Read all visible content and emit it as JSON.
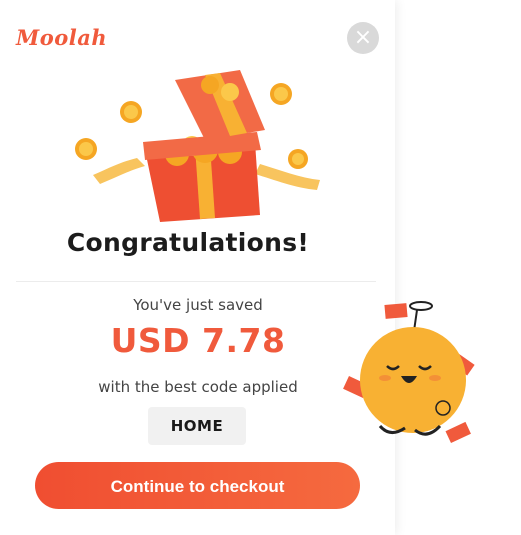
{
  "brand": {
    "logo_text": "Moolah"
  },
  "popup": {
    "title": "Congratulations!",
    "saved_label": "You've just saved",
    "amount": "USD 7.78",
    "code_label": "with the best code applied",
    "code": "HOME",
    "cta_label": "Continue to checkout",
    "close_icon": "×"
  },
  "colors": {
    "accent": "#f05a3c",
    "coin": "#f5a623",
    "mascot": "#f8b133"
  },
  "icons": [
    "close-icon",
    "gift-box-icon",
    "coin-icon",
    "mascot-illustration",
    "money-bill-icon"
  ]
}
